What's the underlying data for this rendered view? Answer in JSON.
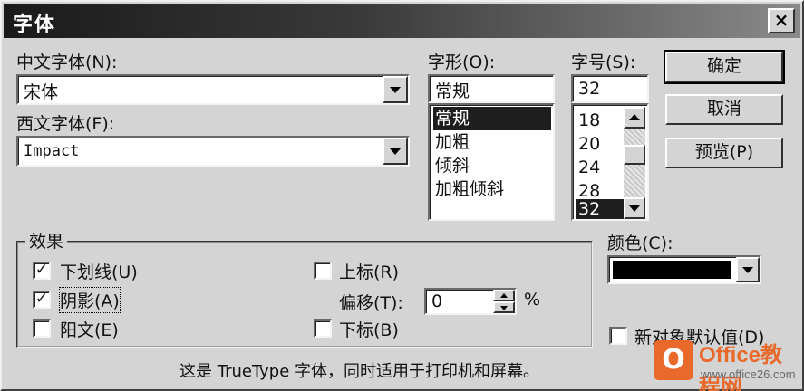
{
  "dialog": {
    "title": "字体",
    "close_symbol": "×"
  },
  "chinese_font": {
    "label": "中文字体(N):",
    "value": "宋体"
  },
  "western_font": {
    "label": "西文字体(F):",
    "value": "Impact"
  },
  "style": {
    "label": "字形(O):",
    "value": "常规",
    "items": [
      "常规",
      "加粗",
      "倾斜",
      "加粗倾斜"
    ],
    "selected_index": 0
  },
  "size": {
    "label": "字号(S):",
    "value": "32",
    "items": [
      "18",
      "20",
      "24",
      "28",
      "32"
    ],
    "selected_index": 4
  },
  "buttons": {
    "ok": "确定",
    "cancel": "取消",
    "preview": "预览(P)"
  },
  "effects": {
    "legend": "效果",
    "underline": {
      "label": "下划线(U)",
      "checked": true,
      "mark": "✓"
    },
    "shadow": {
      "label": "阴影(A)",
      "checked": true,
      "mark": "✓"
    },
    "emboss": {
      "label": "阳文(E)",
      "checked": false,
      "mark": ""
    },
    "superscript": {
      "label": "上标(R)",
      "checked": false,
      "mark": ""
    },
    "offset_label": "偏移(T):",
    "offset_value": "0",
    "offset_unit": "%",
    "subscript": {
      "label": "下标(B)",
      "checked": false,
      "mark": ""
    }
  },
  "color": {
    "label": "颜色(C):",
    "value_hex": "#000000"
  },
  "default_for_new": {
    "label": "新对象默认值(D)",
    "checked": false,
    "mark": ""
  },
  "info_text": "这是 TrueType 字体，同时适用于打印机和屏幕。",
  "watermark": {
    "logo_letter": "O",
    "brand": "Office教程网",
    "url": "www.office26.com"
  },
  "icons": {
    "close": "close-icon",
    "dropdown": "chevron-down-icon",
    "scroll_up": "scroll-up-icon",
    "scroll_down": "scroll-down-icon",
    "spin_up": "spin-up-icon",
    "spin_down": "spin-down-icon"
  }
}
